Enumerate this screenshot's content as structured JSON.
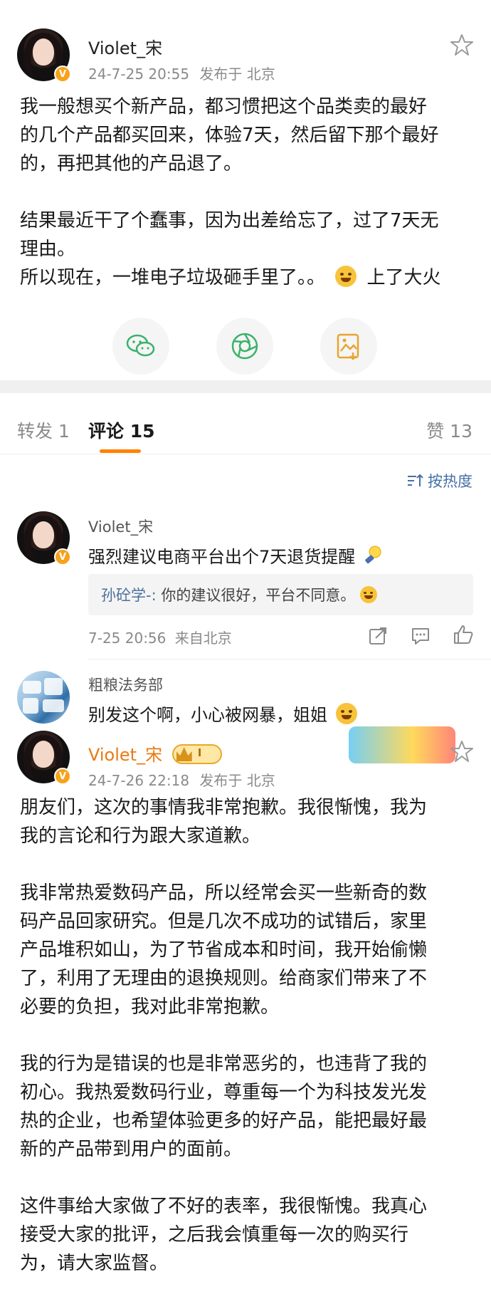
{
  "post": {
    "author": "Violet_宋",
    "time": "24-7-25 20:55",
    "source": "发布于 北京",
    "paragraphs": [
      [
        "我一般想买个新产品，都习惯把这个品类卖的最好",
        "的几个产品都买回来，体验7天，然后留下那个最好",
        "的，再把其他的产品退了。"
      ],
      [
        "结果最近干了个蠢事，因为出差给忘了，过了7天无",
        "理由。",
        "所以现在，一堆电子垃圾砸手里了。。"
      ]
    ],
    "last_suffix": "上了大火",
    "share_icons": [
      "wechat-icon",
      "moments-icon",
      "save-image-icon"
    ]
  },
  "tabs": {
    "repost": "转发 1",
    "comments": "评论 15",
    "likes": "赞 13"
  },
  "sort_label": "按热度",
  "comments": [
    {
      "author": "Violet_宋",
      "text": "强烈建议电商平台出个7天退货提醒",
      "reply_name": "孙砼学-:",
      "reply_text": "你的建议很好，平台不同意。",
      "time": "7-25 20:56",
      "location": "来自北京"
    },
    {
      "author": "粗粮法务部",
      "text": "别发这个啊，小心被网暴，姐姐"
    }
  ],
  "apology_post": {
    "author": "Violet_宋",
    "vip_level": "I",
    "time": "24-7-26 22:18",
    "source": "发布于 北京",
    "paragraphs": [
      [
        "朋友们，这次的事情我非常抱歉。我很惭愧，我为",
        "我的言论和行为跟大家道歉。"
      ],
      [
        "我非常热爱数码产品，所以经常会买一些新奇的数",
        "码产品回家研究。但是几次不成功的试错后，家里",
        "产品堆积如山，为了节省成本和时间，我开始偷懒",
        "了，利用了无理由的退换规则。给商家们带来了不",
        "必要的负担，我对此非常抱歉。"
      ],
      [
        "我的行为是错误的也是非常恶劣的，也违背了我的",
        "初心。我热爱数码行业，尊重每一个为科技发光发",
        "热的企业，也希望体验更多的好产品，能把最好最",
        "新的产品带到用户的面前。"
      ],
      [
        "这件事给大家做了不好的表率，我很惭愧。我真心",
        "接受大家的批评，之后我会慎重每一次的购买行",
        "为，请大家监督。"
      ]
    ]
  },
  "colors": {
    "accent": "#ff8200",
    "link": "#456fa5",
    "divider": "#f0f0f0"
  }
}
